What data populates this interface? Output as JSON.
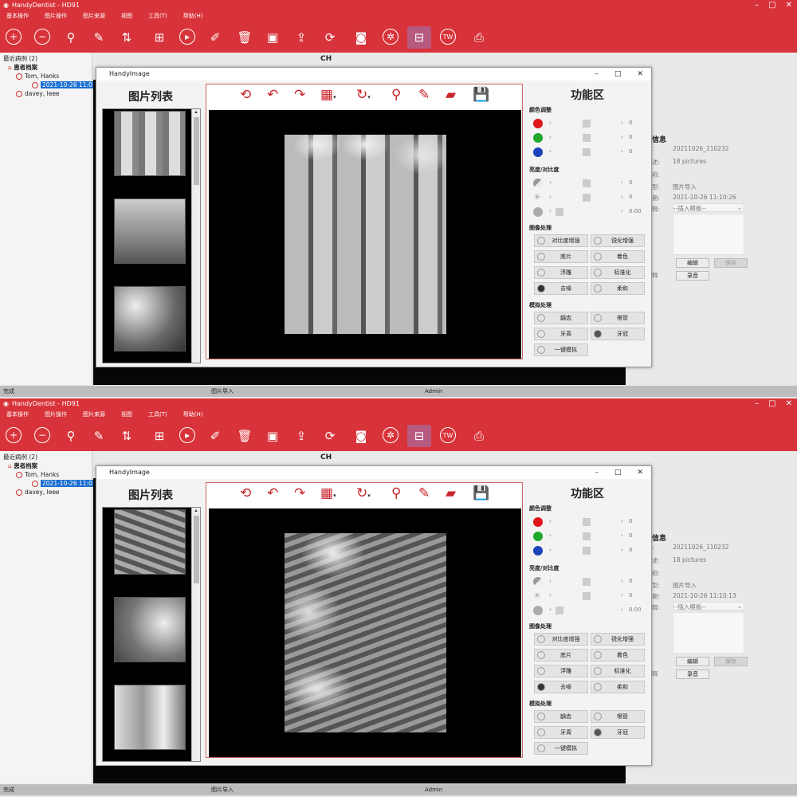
{
  "app": {
    "title": "HandyDentist - HD91",
    "menu": [
      "基本操作",
      "图片操作",
      "图片来源",
      "视图",
      "工具(T)",
      "帮助(H)"
    ],
    "toolbar_icons": [
      "add-icon",
      "remove-icon",
      "search-icon",
      "pencil-icon",
      "sort-icon",
      "grid-icon",
      "play-icon",
      "edit-icon",
      "trash-icon",
      "image-icon",
      "export-icon",
      "refresh-icon",
      "camera-icon",
      "aperture-icon",
      "scan-icon",
      "tw-icon",
      "printer-icon"
    ],
    "win_min": "–",
    "win_max": "□",
    "win_close": "✕",
    "tree": {
      "recent": "最近病例 (2)",
      "root": "患者档案",
      "patient1": "Tom, Hanks",
      "record": "2021-10-26 11:0",
      "patient2": "davey, leee"
    },
    "center_label": "CH",
    "status": {
      "left": "完成",
      "mid": "图片导入",
      "user": "Admin"
    },
    "dialog": {
      "title": "HandyImage",
      "list_heading": "图片列表",
      "func_heading": "功能区",
      "sec_color": "颜色调整",
      "sec_bright": "亮度/对比度",
      "sec_image": "图像处理",
      "sec_sim": "模拟处理",
      "color_values": [
        "0",
        "0",
        "0"
      ],
      "bright_values": [
        "0",
        "0",
        "0.00"
      ],
      "image_buttons": [
        "对比度增强",
        "锐化增强",
        "底片",
        "着色",
        "浮雕",
        "标准化",
        "去噪",
        "柔和"
      ],
      "sim_buttons": [
        "龋齿",
        "根管",
        "牙周",
        "牙冠",
        "一键模拟"
      ]
    },
    "info": {
      "heading": "信息",
      "labels": [
        ":",
        "述:",
        "称:",
        "型:",
        "期:",
        "释:"
      ],
      "name": "20211026_110232",
      "desc": "18 pictures",
      "type": "图片导入",
      "template": "--插入模板--",
      "edit": "编辑",
      "save": "保存",
      "record": "录音",
      "note_label": "释"
    },
    "colors": {
      "brand": "#d8333a",
      "red": "#e0161c",
      "green": "#1fa82a",
      "blue": "#1c44b8"
    }
  },
  "screens": [
    {
      "info_date": "2021-10-26 11:10:26"
    },
    {
      "info_date": "2021-10-26 11:10:13"
    }
  ]
}
